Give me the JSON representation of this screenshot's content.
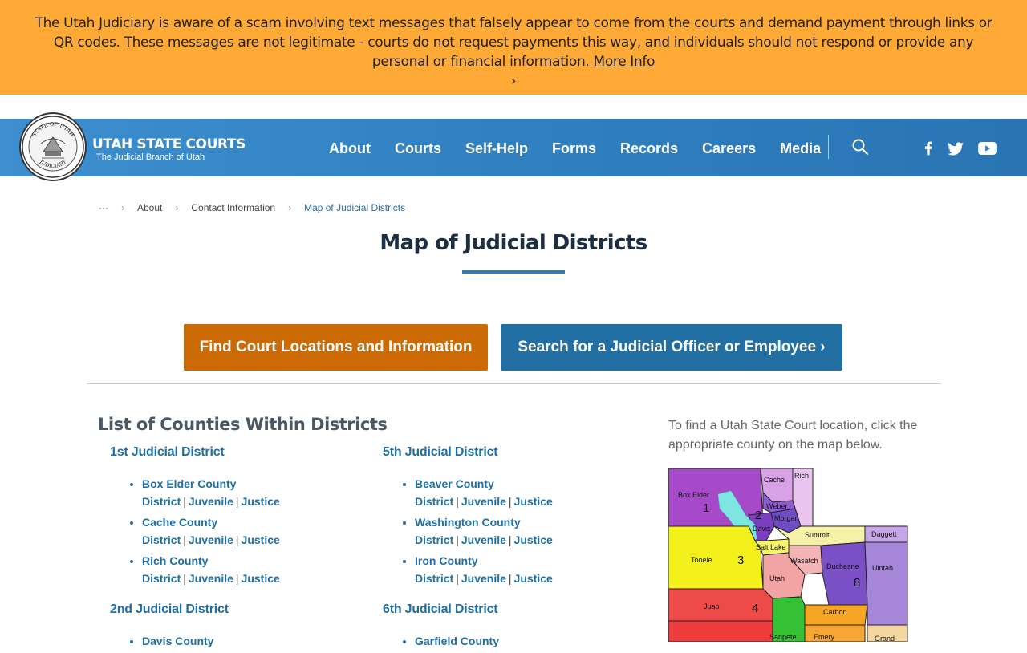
{
  "alert": {
    "text": "The Utah Judiciary is aware of a scam involving text messages that falsely appear to come from the courts and demand payment through links or QR codes. These messages are not legitimate - courts do not request payments this way, and individuals should not respond or provide any personal or financial information.",
    "link_label": "More Info",
    "chevron": "›",
    "color": "#ffaa36"
  },
  "header": {
    "brand_name": "UTAH STATE COURTS",
    "brand_sub": "The Judicial Branch of Utah",
    "seal_text_top": "STATE OF UTAH",
    "seal_text_bottom": "JUDICIARY",
    "nav": [
      "About",
      "Courts",
      "Self-Help",
      "Forms",
      "Records",
      "Careers",
      "Media"
    ],
    "search_icon": "search-icon",
    "social_icons": [
      "facebook-icon",
      "twitter-icon",
      "youtube-icon"
    ],
    "color": "#2f7fbf"
  },
  "breadcrumb": {
    "ellipsis": "···",
    "items": [
      "About",
      "Contact Information"
    ],
    "current": "Map of Judicial Districts",
    "separator": "›"
  },
  "page": {
    "title": "Map of Judicial Districts",
    "btn_find": "Find Court Locations and Information",
    "btn_search": "Search for a Judicial Officer or Employee ›",
    "list_heading": "List of Counties Within Districts",
    "map_intro": "To find a Utah State Court location, click the appropriate county on the map below."
  },
  "court_links": [
    "District",
    "Juvenile",
    "Justice"
  ],
  "districts": [
    {
      "title": "1st Judicial District",
      "counties": [
        "Box Elder County",
        "Cache County",
        "Rich County"
      ]
    },
    {
      "title": "5th Judicial District",
      "counties": [
        "Beaver County",
        "Washington County",
        "Iron County"
      ]
    },
    {
      "title": "2nd Judicial District",
      "counties": [
        "Davis County"
      ]
    },
    {
      "title": "6th Judicial District",
      "counties": [
        "Garfield County"
      ]
    }
  ],
  "map": {
    "counties": [
      "Box Elder",
      "Cache",
      "Rich",
      "Weber",
      "Morgan",
      "Davis",
      "Summit",
      "Daggett",
      "Salt Lake",
      "Tooele",
      "Wasatch",
      "Duchesne",
      "Uintah",
      "Utah",
      "Juab",
      "Carbon",
      "Sanpete",
      "Emery",
      "Grand"
    ],
    "district_numbers": [
      "1",
      "2",
      "3",
      "4",
      "8"
    ]
  }
}
